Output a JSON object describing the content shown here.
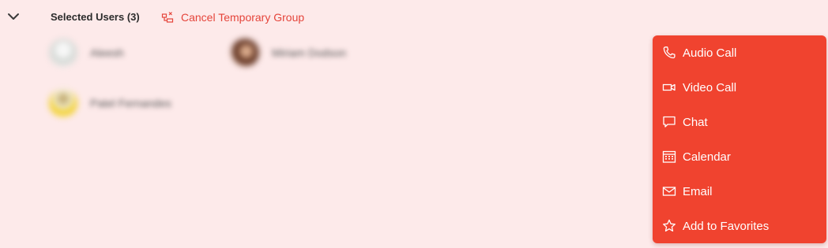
{
  "header": {
    "title": "Selected Users (3)",
    "cancel_label": "Cancel Temporary Group"
  },
  "users": [
    {
      "name": "Aleesh",
      "avatar": "light-avatar"
    },
    {
      "name": "Miriam Dodson",
      "avatar": "photo-avatar"
    },
    {
      "name": "Patel Fernandes",
      "avatar": "yellow-avatar"
    }
  ],
  "context_menu": {
    "items": [
      {
        "label": "Audio Call",
        "icon": "phone-icon"
      },
      {
        "label": "Video Call",
        "icon": "video-icon"
      },
      {
        "label": "Chat",
        "icon": "chat-icon"
      },
      {
        "label": "Calendar",
        "icon": "calendar-icon"
      },
      {
        "label": "Email",
        "icon": "mail-icon"
      },
      {
        "label": "Add to Favorites",
        "icon": "star-icon"
      }
    ]
  },
  "colors": {
    "background": "#fdeaea",
    "accent": "#e5443a",
    "menu_background": "#f0432f",
    "menu_text": "#ffffff"
  }
}
